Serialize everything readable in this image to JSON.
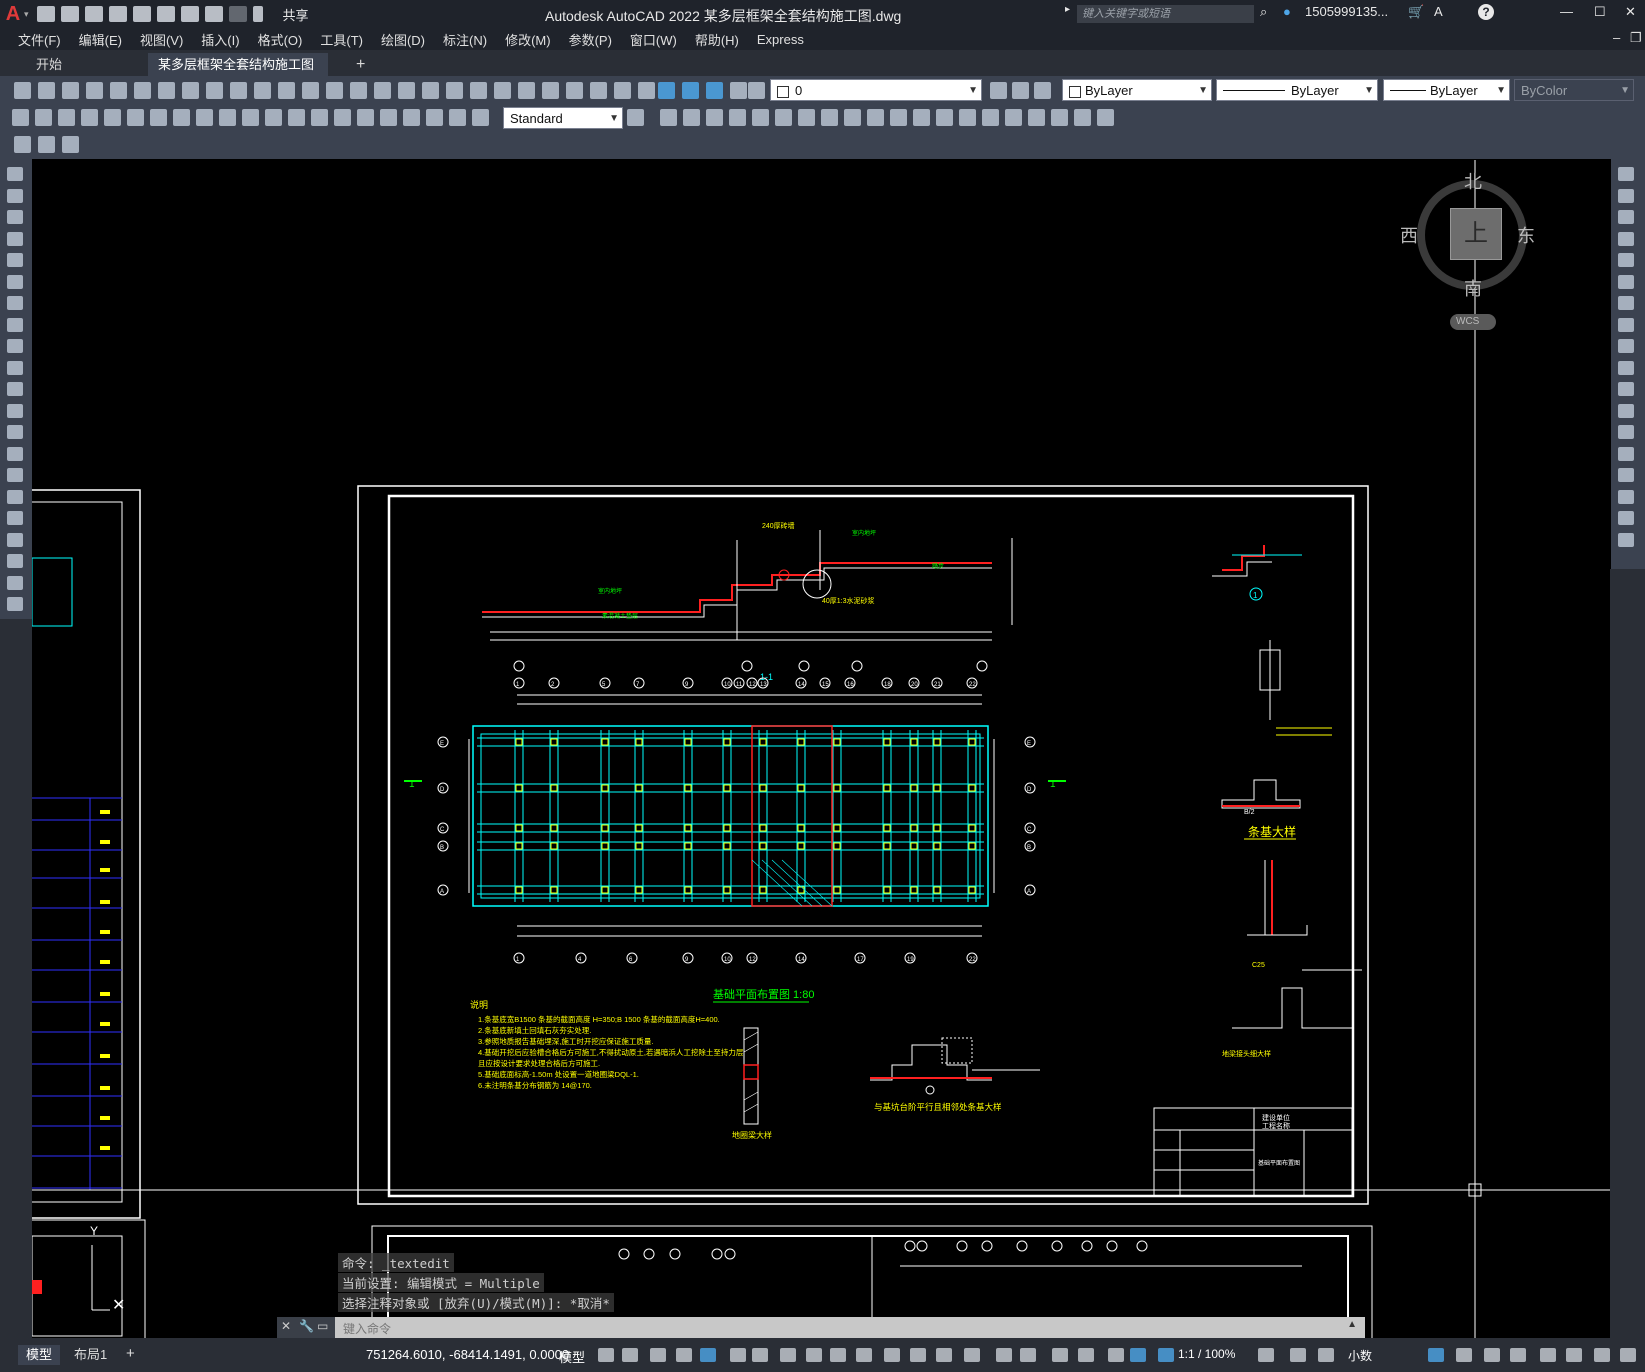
{
  "app": {
    "title": "Autodesk AutoCAD 2022    某多层框架全套结构施工图.dwg",
    "share_label": "共享",
    "search_placeholder": "键入关键字或短语",
    "user": "1505999135...",
    "help": "?"
  },
  "menus": [
    "文件(F)",
    "编辑(E)",
    "视图(V)",
    "插入(I)",
    "格式(O)",
    "工具(T)",
    "绘图(D)",
    "标注(N)",
    "修改(M)",
    "参数(P)",
    "窗口(W)",
    "帮助(H)",
    "Express"
  ],
  "tabs": [
    {
      "label": "开始"
    },
    {
      "label": "某多层框架全套结构施工图*"
    }
  ],
  "toolbar": {
    "layer_value": "0",
    "text_style": "Standard",
    "color": "ByLayer",
    "linetype": "ByLayer",
    "lineweight": "ByLayer",
    "plotstyle": "ByColor"
  },
  "viewcube": {
    "north": "北",
    "south": "南",
    "east": "东",
    "west": "西",
    "top": "上",
    "wcs": "WCS"
  },
  "drawing": {
    "titles": {
      "section": "1-1",
      "plan": "基础平面布置图  1:80",
      "strip": "条基大样",
      "pile_cap": "与基坑台阶平行且相邻处条基大样",
      "beam": "地圈梁大样",
      "notes_title": "说明",
      "jl": "地梁接头细大样",
      "detail_num": "1"
    },
    "axis_top": [
      "1",
      "2",
      "5",
      "7",
      "9",
      "10",
      "11",
      "12",
      "13",
      "14",
      "15",
      "16",
      "18",
      "20",
      "21",
      "22"
    ],
    "axis_bottom": [
      "1",
      "4",
      "6",
      "9",
      "10",
      "12",
      "14",
      "17",
      "19",
      "22"
    ],
    "axis_side": [
      "E",
      "D",
      "C",
      "B",
      "A"
    ],
    "notes": [
      "1.条基底宽B1500 条基的截面高度 H=350;B 1500 条基的截面高度H=400.",
      "2.条基底新填土回填石灰夯实处理.",
      "3.参照地质报告基础埋深,施工时开挖应保证施工质量.",
      "4.基础开挖后应验槽合格后方可施工,不得扰动原土,若遇暗浜人工挖除土至持力层",
      "  且应按设计要求处理合格后方可施工.",
      "5.基础底面标高-1.50m 处设置一道地圈梁DQL-1.",
      "6.未注明条基分布钢筋为 14@170."
    ],
    "dims": {
      "b2": "B/2",
      "c25": "C25"
    },
    "titleblock": {
      "unit": "建设单位",
      "project": "工程名称",
      "name": "基础平面布置图"
    }
  },
  "command": {
    "line1": "命令: _textedit",
    "line2": "当前设置: 编辑模式 = Multiple",
    "line3": "选择注释对象或 [放弃(U)/模式(M)]: *取消*",
    "placeholder": "键入命令"
  },
  "status": {
    "tab_model": "模型",
    "tab_layout": "布局1",
    "coords": "751264.6010, -68414.1491, 0.0000",
    "space": "模型",
    "scale": "1:1 / 100%",
    "units": "小数"
  },
  "colors": {
    "accent": "#4ea6e8",
    "cyan": "#00ffff",
    "red": "#ff2020",
    "yellow": "#ffff00"
  }
}
